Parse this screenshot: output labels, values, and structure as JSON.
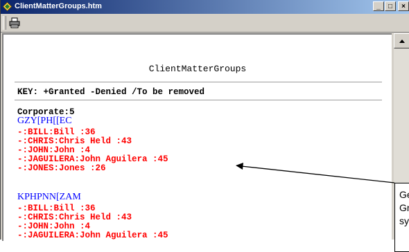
{
  "window": {
    "title": "ClientMatterGroups.htm",
    "controls": {
      "minimize": "_",
      "maximize": "□",
      "close": "×"
    }
  },
  "toolbar": {
    "print_icon": "printer-icon"
  },
  "page": {
    "title": "ClientMatterGroups",
    "key": "KEY: +Granted -Denied /To be removed",
    "section": "Corporate:5"
  },
  "groups": [
    {
      "name": "GZY[PH[[EC",
      "entries": [
        "-:BILL:Bill :36",
        "-:CHRIS:Chris Held :43",
        "-:JOHN:John :4",
        "-:JAGUILERA:John Aguilera :45",
        "-:JONES:Jones :26"
      ]
    },
    {
      "name": "KPHPNN[ZAM",
      "entries": [
        "-:BILL:Bill :36",
        "-:CHRIS:Chris Held :43",
        "-:JOHN:John :4",
        "-:JAGUILERA:John Aguilera :45"
      ]
    }
  ],
  "callout": {
    "lines": [
      "Ge",
      "Gro",
      "sys"
    ]
  },
  "colors": {
    "group": "#0000ff",
    "entry": "#ff0000",
    "titlebar_start": "#0a246a",
    "titlebar_end": "#a6caf0"
  }
}
